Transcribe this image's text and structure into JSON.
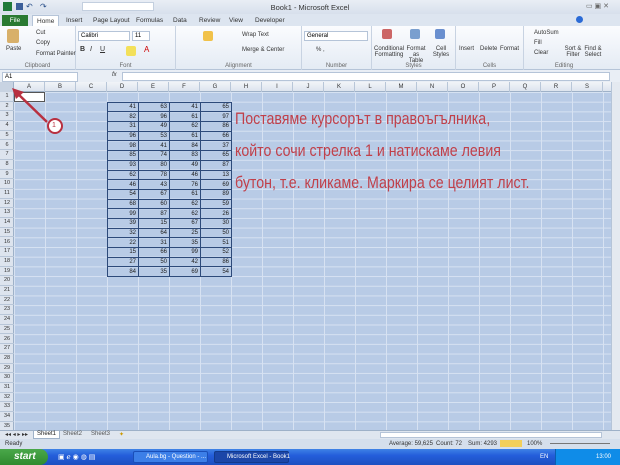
{
  "window": {
    "title": "Book1 - Microsoft Excel"
  },
  "ribbon_tabs": [
    "File",
    "Home",
    "Insert",
    "Page Layout",
    "Formulas",
    "Data",
    "Review",
    "View",
    "Developer"
  ],
  "clipboard": {
    "paste": "Paste",
    "cut": "Cut",
    "copy": "Copy",
    "format_painter": "Format Painter",
    "label": "Clipboard"
  },
  "font": {
    "name": "Calibri",
    "size": "11",
    "label": "Font"
  },
  "alignment": {
    "wrap": "Wrap Text",
    "merge": "Merge & Center",
    "label": "Alignment"
  },
  "number": {
    "format": "General",
    "label": "Number"
  },
  "styles": {
    "conditional": "Conditional Formatting",
    "table": "Format as Table",
    "cell": "Cell Styles",
    "label": "Styles"
  },
  "cells": {
    "insert": "Insert",
    "delete": "Delete",
    "format": "Format",
    "label": "Cells"
  },
  "editing": {
    "autosum": "AutoSum",
    "fill": "Fill",
    "clear": "Clear",
    "sort": "Sort & Filter",
    "find": "Find & Select",
    "label": "Editing"
  },
  "formula_bar": {
    "name_box": "A1",
    "fx": "fx",
    "value": ""
  },
  "columns": [
    "A",
    "B",
    "C",
    "D",
    "E",
    "F",
    "G",
    "H",
    "I",
    "J",
    "K",
    "L",
    "M",
    "N",
    "O",
    "P",
    "Q",
    "R",
    "S"
  ],
  "rows": 35,
  "table": [
    [
      41,
      63,
      41,
      65
    ],
    [
      82,
      96,
      61,
      97
    ],
    [
      31,
      49,
      62,
      86
    ],
    [
      96,
      53,
      61,
      66
    ],
    [
      98,
      41,
      84,
      37
    ],
    [
      85,
      74,
      83,
      65
    ],
    [
      93,
      80,
      49,
      87
    ],
    [
      62,
      78,
      46,
      13
    ],
    [
      46,
      43,
      76,
      69
    ],
    [
      54,
      67,
      61,
      89
    ],
    [
      68,
      60,
      62,
      59
    ],
    [
      99,
      87,
      62,
      26
    ],
    [
      39,
      15,
      67,
      30
    ],
    [
      32,
      64,
      25,
      50
    ],
    [
      22,
      31,
      35,
      51
    ],
    [
      15,
      66,
      99,
      52
    ],
    [
      27,
      50,
      42,
      86
    ],
    [
      84,
      35,
      69,
      54
    ]
  ],
  "annotation": {
    "marker": "1",
    "lines": [
      "Поставяме курсорът в правоъгълника,",
      "който сочи стрелка 1 и натискаме левия",
      "бутон, т.е. кликаме. Маркира се целият лист."
    ]
  },
  "sheets": [
    "Sheet1",
    "Sheet2",
    "Sheet3"
  ],
  "status": {
    "mode": "Ready",
    "average": "Average: 59,625",
    "count": "Count: 72",
    "sum": "Sum: 4293",
    "zoom": "100%"
  },
  "taskbar": {
    "start": "start",
    "items": [
      "Aula.bg - Question - ...",
      "Microsoft Excel - Book1"
    ],
    "lang": "EN",
    "time": "13:00"
  }
}
